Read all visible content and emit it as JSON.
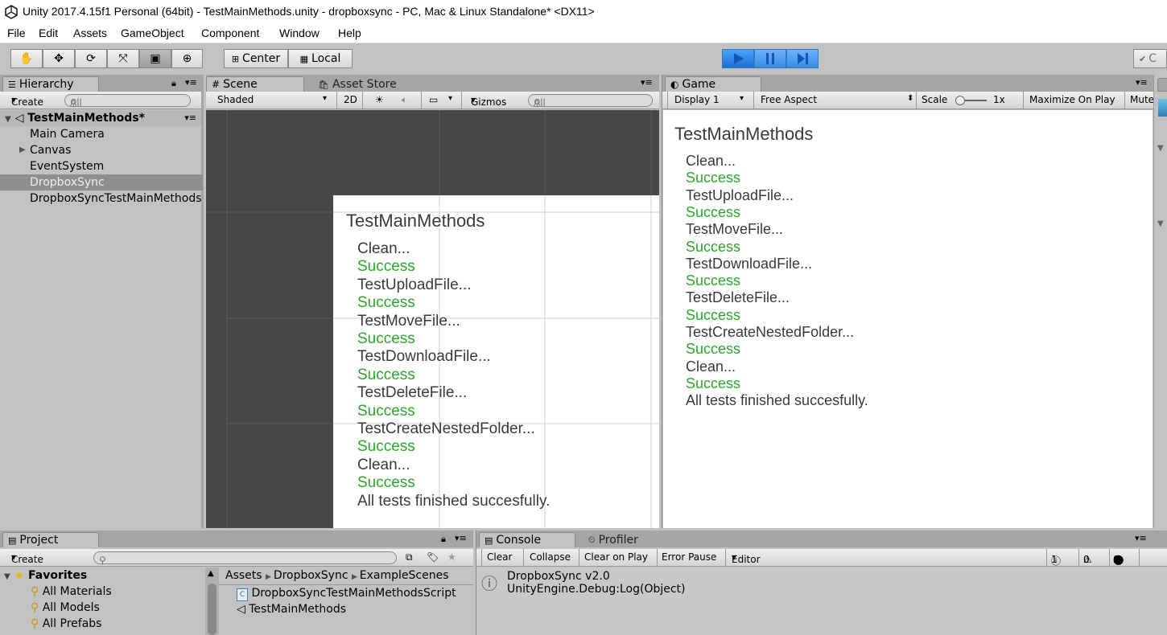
{
  "window": {
    "title": "Unity 2017.4.15f1 Personal (64bit) - TestMainMethods.unity - dropboxsync - PC, Mac & Linux Standalone* <DX11>"
  },
  "menu": [
    "File",
    "Edit",
    "Assets",
    "GameObject",
    "Component",
    "Window",
    "Help"
  ],
  "toolbar": {
    "center": "Center",
    "local": "Local",
    "cloud": "C"
  },
  "hierarchy": {
    "tab": "Hierarchy",
    "create": "Create",
    "search_placeholder": "All",
    "scene": "TestMainMethods*",
    "items": [
      "Main Camera",
      "Canvas",
      "EventSystem",
      "DropboxSync",
      "DropboxSyncTestMainMethods"
    ]
  },
  "scene": {
    "tab": "Scene",
    "tab2": "Asset Store",
    "shading": "Shaded",
    "mode2d": "2D",
    "gizmos": "Gizmos",
    "search_placeholder": "All"
  },
  "game": {
    "tab": "Game",
    "display": "Display 1",
    "aspect": "Free Aspect",
    "scale_label": "Scale",
    "scale_value": "1x",
    "maximize": "Maximize On Play",
    "mute": "Mute"
  },
  "test_ui": {
    "title": "TestMainMethods",
    "lines": [
      {
        "text": "Clean...",
        "status": "normal"
      },
      {
        "text": "Success",
        "status": "success"
      },
      {
        "text": "TestUploadFile...",
        "status": "normal"
      },
      {
        "text": "Success",
        "status": "success"
      },
      {
        "text": "TestMoveFile...",
        "status": "normal"
      },
      {
        "text": "Success",
        "status": "success"
      },
      {
        "text": "TestDownloadFile...",
        "status": "normal"
      },
      {
        "text": "Success",
        "status": "success"
      },
      {
        "text": "TestDeleteFile...",
        "status": "normal"
      },
      {
        "text": "Success",
        "status": "success"
      },
      {
        "text": "TestCreateNestedFolder...",
        "status": "normal"
      },
      {
        "text": "Success",
        "status": "success"
      },
      {
        "text": "Clean...",
        "status": "normal"
      },
      {
        "text": "Success",
        "status": "success"
      },
      {
        "text": "All tests finished succesfully.",
        "status": "normal"
      }
    ],
    "success_color": "#2aa52a",
    "text_color": "#3a3a3a"
  },
  "project": {
    "tab": "Project",
    "create": "Create",
    "favorites": "Favorites",
    "favorite_items": [
      "All Materials",
      "All Models",
      "All Prefabs"
    ],
    "breadcrumb": [
      "Assets",
      "DropboxSync",
      "ExampleScenes"
    ],
    "files": [
      "DropboxSyncTestMainMethodsScript",
      "TestMainMethods"
    ]
  },
  "console": {
    "tab": "Console",
    "tab2": "Profiler",
    "buttons": [
      "Clear",
      "Collapse",
      "Clear on Play",
      "Error Pause",
      "Editor"
    ],
    "counts": {
      "info": "1",
      "warnings": "0",
      "errors": "0"
    },
    "log_line1": "DropboxSync v2.0",
    "log_line2": "UnityEngine.Debug:Log(Object)"
  }
}
